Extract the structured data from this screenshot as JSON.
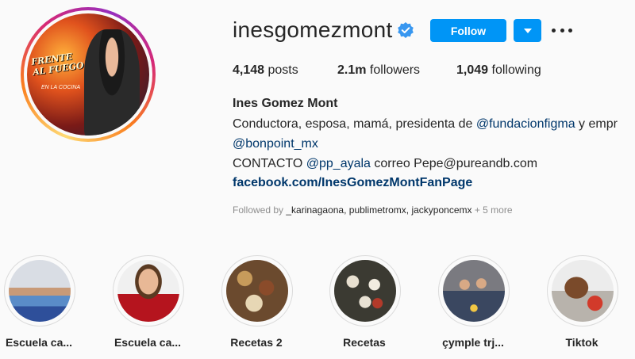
{
  "profile": {
    "username": "inesgomezmont",
    "follow_label": "Follow",
    "stats": {
      "posts_value": "4,148",
      "posts_label": "posts",
      "followers_value": "2.1m",
      "followers_label": "followers",
      "following_value": "1,049",
      "following_label": "following"
    },
    "avatar_text_1": "FRENTE AL FUEGO",
    "avatar_text_2": "EN LA COCINA",
    "bio": {
      "name": "Ines Gomez Mont",
      "line1_text": "Conductora, esposa, mamá, presidenta de ",
      "line1_mention": "@fundacionfigma",
      "line1_rest": " y empr",
      "line2_mention": "@bonpoint_mx",
      "line3_text_a": "CONTACTO ",
      "line3_mention": "@pp_ayala",
      "line3_text_b": " correo Pepe@pureandb.com",
      "website": "facebook.com/InesGomezMontFanPage"
    },
    "followed_by": {
      "prefix": "Followed by ",
      "users": "_karinagaona, publimetromx, jackyponcemx",
      "more": " + 5 more"
    }
  },
  "highlights": [
    {
      "label": "Escuela ca...",
      "icon": "highlight-escuela-1"
    },
    {
      "label": "Escuela ca...",
      "icon": "highlight-escuela-2"
    },
    {
      "label": "Recetas 2",
      "icon": "highlight-recetas-2"
    },
    {
      "label": "Recetas",
      "icon": "highlight-recetas"
    },
    {
      "label": "çymple trj...",
      "icon": "highlight-cumple"
    },
    {
      "label": "Tiktok",
      "icon": "highlight-tiktok"
    }
  ],
  "colors": {
    "accent": "#0095f6",
    "link": "#00376b",
    "muted": "#8e8e8e",
    "text": "#262626",
    "background": "#fafafa"
  }
}
